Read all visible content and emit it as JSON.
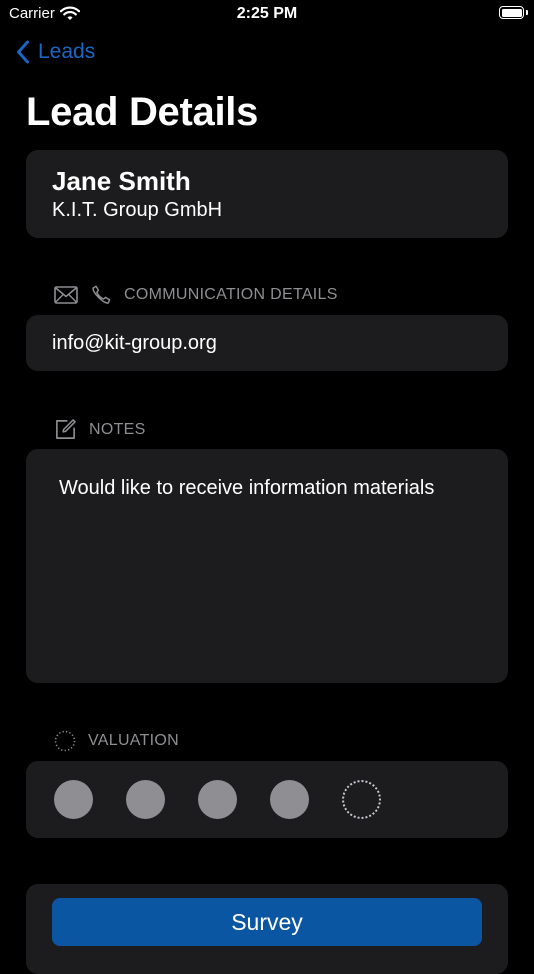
{
  "status_bar": {
    "carrier": "Carrier",
    "time": "2:25 PM",
    "icons": [
      "wifi-icon",
      "battery-icon"
    ]
  },
  "nav": {
    "back_label": "Leads",
    "back_icon": "chevron-left-icon"
  },
  "page": {
    "title": "Lead Details"
  },
  "lead": {
    "name": "Jane Smith",
    "company": "K.I.T. Group GmbH"
  },
  "communication": {
    "header": "COMMUNICATION DETAILS",
    "icons": [
      "envelope-icon",
      "phone-icon"
    ],
    "email": "info@kit-group.org"
  },
  "notes": {
    "header": "NOTES",
    "icon": "compose-icon",
    "text": "Would like to receive information materials"
  },
  "valuation": {
    "header": "VALUATION",
    "icon": "dotted-circle-icon",
    "rating": 4,
    "max_rating": 5
  },
  "actions": {
    "survey_label": "Survey"
  },
  "colors": {
    "background": "#000000",
    "card": "#1c1c1e",
    "accent": "#1a66c5",
    "button": "#0a56a3",
    "secondary_text": "#8e8e93"
  }
}
